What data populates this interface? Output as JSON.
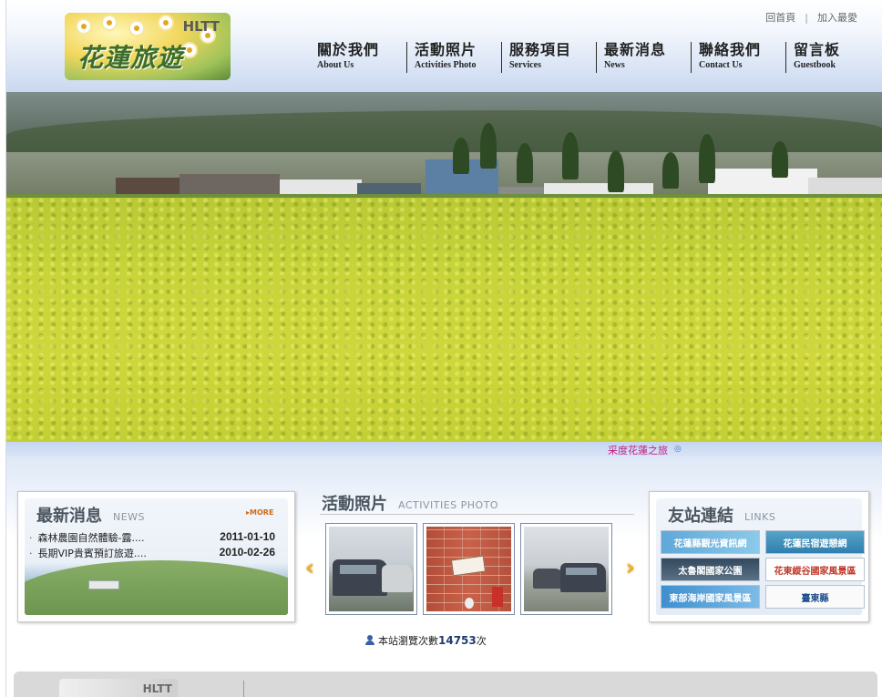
{
  "header": {
    "logo_title": "花蓮旅遊",
    "logo_abbr": "HLTT",
    "top_links": [
      {
        "label": "回首頁"
      },
      {
        "label": "加入最愛"
      }
    ],
    "nav": [
      {
        "zh": "關於我們",
        "en": "About Us"
      },
      {
        "zh": "活動照片",
        "en": "Activities Photo"
      },
      {
        "zh": "服務項目",
        "en": "Services"
      },
      {
        "zh": "最新消息",
        "en": "News"
      },
      {
        "zh": "聯絡我們",
        "en": "Contact Us"
      },
      {
        "zh": "留言板",
        "en": "Guestbook"
      }
    ]
  },
  "banner": {
    "caption": "采度花蓮之旅"
  },
  "news": {
    "title_zh": "最新消息",
    "title_en": "NEWS",
    "more_label": "MORE",
    "items": [
      {
        "title": "森林農園自然體驗-露....",
        "date": "2011-01-10"
      },
      {
        "title": "長期VIP貴賓預訂旅遊....",
        "date": "2010-02-26"
      }
    ]
  },
  "photos": {
    "title_zh": "活動照片",
    "title_en": "ACTIVITIES PHOTO",
    "prev_icon": "chevron-left-icon",
    "next_icon": "chevron-right-icon"
  },
  "links": {
    "title_zh": "友站連結",
    "title_en": "LINKS",
    "items": [
      {
        "label": "花蓮縣觀光資訊網"
      },
      {
        "label": "花蓮民宿遊憩網"
      },
      {
        "label": "太魯閣國家公園"
      },
      {
        "label": "花東縱谷國家風景區"
      },
      {
        "label": "東部海岸國家風景區"
      },
      {
        "label": "臺東縣"
      }
    ]
  },
  "counter": {
    "prefix": "本站瀏覽次數",
    "count": "14753",
    "suffix": "次"
  },
  "footer": {
    "logo_abbr": "HLTT"
  },
  "colors": {
    "nav_text": "#222222",
    "caption": "#c0208a",
    "more": "#d06a15",
    "arrow": "#f0b21a"
  }
}
